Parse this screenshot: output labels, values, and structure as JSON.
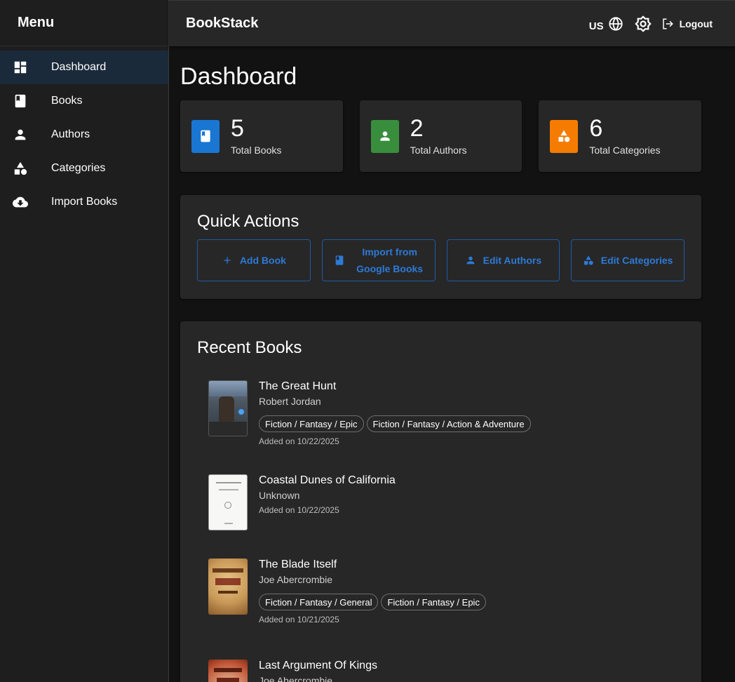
{
  "sidebar": {
    "title": "Menu",
    "items": [
      {
        "label": "Dashboard",
        "icon": "dashboard-icon",
        "active": true
      },
      {
        "label": "Books",
        "icon": "book-icon"
      },
      {
        "label": "Authors",
        "icon": "person-icon"
      },
      {
        "label": "Categories",
        "icon": "category-icon"
      },
      {
        "label": "Import Books",
        "icon": "cloud-download-icon"
      }
    ]
  },
  "topbar": {
    "brand": "BookStack",
    "language": "US",
    "logout_label": "Logout"
  },
  "main": {
    "title": "Dashboard",
    "stats": [
      {
        "value": "5",
        "label": "Total Books",
        "color": "#1976d2",
        "icon": "book-icon"
      },
      {
        "value": "2",
        "label": "Total Authors",
        "color": "#388e3c",
        "icon": "person-icon"
      },
      {
        "value": "6",
        "label": "Total Categories",
        "color": "#f57c00",
        "icon": "category-icon"
      }
    ],
    "quick_actions": {
      "title": "Quick Actions",
      "buttons": [
        {
          "label": "Add Book",
          "icon": "plus-icon"
        },
        {
          "label_line1": "Import from",
          "label_line2": "Google Books",
          "icon": "book-icon"
        },
        {
          "label": "Edit Authors",
          "icon": "person-icon"
        },
        {
          "label": "Edit Categories",
          "icon": "category-icon"
        }
      ]
    },
    "recent_books": {
      "title": "Recent Books",
      "books": [
        {
          "title": "The Great Hunt",
          "author": "Robert Jordan",
          "categories": [
            "Fiction / Fantasy / Epic",
            "Fiction / Fantasy / Action & Adventure"
          ],
          "added": "Added on 10/22/2025"
        },
        {
          "title": "Coastal Dunes of California",
          "author": "Unknown",
          "categories": [],
          "added": "Added on 10/22/2025"
        },
        {
          "title": "The Blade Itself",
          "author": "Joe Abercrombie",
          "categories": [
            "Fiction / Fantasy / General",
            "Fiction / Fantasy / Epic"
          ],
          "added": "Added on 10/21/2025"
        },
        {
          "title": "Last Argument Of Kings",
          "author": "Joe Abercrombie",
          "categories": [],
          "added": ""
        }
      ]
    }
  },
  "colors": {
    "accent": "#2d7ad6",
    "active_nav": "#1b2a3a"
  }
}
